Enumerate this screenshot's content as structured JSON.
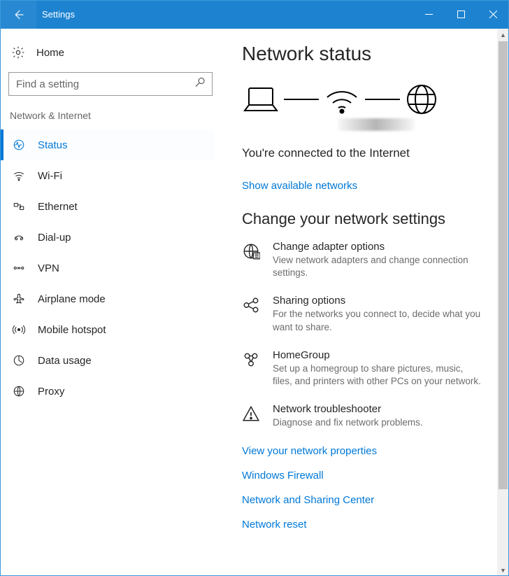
{
  "window": {
    "title": "Settings"
  },
  "sidebar": {
    "home_label": "Home",
    "search_placeholder": "Find a setting",
    "category_label": "Network & Internet",
    "items": [
      {
        "label": "Status"
      },
      {
        "label": "Wi-Fi"
      },
      {
        "label": "Ethernet"
      },
      {
        "label": "Dial-up"
      },
      {
        "label": "VPN"
      },
      {
        "label": "Airplane mode"
      },
      {
        "label": "Mobile hotspot"
      },
      {
        "label": "Data usage"
      },
      {
        "label": "Proxy"
      }
    ]
  },
  "main": {
    "title": "Network status",
    "connection_message": "You're connected to the Internet",
    "show_networks_link": "Show available networks",
    "change_heading": "Change your network settings",
    "settings": [
      {
        "title": "Change adapter options",
        "desc": "View network adapters and change connection settings."
      },
      {
        "title": "Sharing options",
        "desc": "For the networks you connect to, decide what you want to share."
      },
      {
        "title": "HomeGroup",
        "desc": "Set up a homegroup to share pictures, music, files, and printers with other PCs on your network."
      },
      {
        "title": "Network troubleshooter",
        "desc": "Diagnose and fix network problems."
      }
    ],
    "links": [
      "View your network properties",
      "Windows Firewall",
      "Network and Sharing Center",
      "Network reset"
    ]
  }
}
